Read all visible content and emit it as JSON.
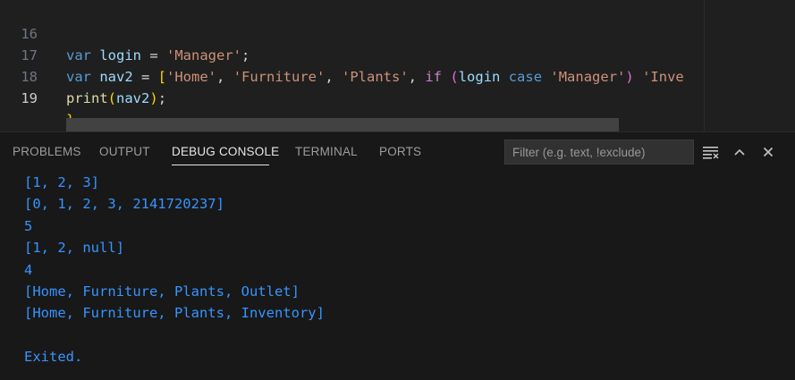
{
  "editor": {
    "lines": [
      {
        "number": "16",
        "active": false,
        "tokens": [
          {
            "t": "var",
            "c": "kw"
          },
          {
            "t": " ",
            "c": "op"
          },
          {
            "t": "login",
            "c": "id"
          },
          {
            "t": " = ",
            "c": "op"
          },
          {
            "t": "'Manager'",
            "c": "str"
          },
          {
            "t": ";",
            "c": "op"
          }
        ]
      },
      {
        "number": "17",
        "active": false,
        "tokens": [
          {
            "t": "var",
            "c": "kw"
          },
          {
            "t": " ",
            "c": "op"
          },
          {
            "t": "nav2",
            "c": "id"
          },
          {
            "t": " = ",
            "c": "op"
          },
          {
            "t": "[",
            "c": "brk1"
          },
          {
            "t": "'Home'",
            "c": "str"
          },
          {
            "t": ", ",
            "c": "op"
          },
          {
            "t": "'Furniture'",
            "c": "str"
          },
          {
            "t": ", ",
            "c": "op"
          },
          {
            "t": "'Plants'",
            "c": "str"
          },
          {
            "t": ", ",
            "c": "op"
          },
          {
            "t": "if",
            "c": "ctl"
          },
          {
            "t": " ",
            "c": "op"
          },
          {
            "t": "(",
            "c": "brk2"
          },
          {
            "t": "login",
            "c": "id"
          },
          {
            "t": " ",
            "c": "op"
          },
          {
            "t": "case",
            "c": "kw"
          },
          {
            "t": " ",
            "c": "op"
          },
          {
            "t": "'Manager'",
            "c": "str"
          },
          {
            "t": ")",
            "c": "brk2"
          },
          {
            "t": " ",
            "c": "op"
          },
          {
            "t": "'Inve",
            "c": "str"
          }
        ]
      },
      {
        "number": "18",
        "active": false,
        "tokens": [
          {
            "t": "print",
            "c": "fn"
          },
          {
            "t": "(",
            "c": "brk1"
          },
          {
            "t": "nav2",
            "c": "id"
          },
          {
            "t": ")",
            "c": "brk1"
          },
          {
            "t": ";",
            "c": "op"
          }
        ]
      },
      {
        "number": "19",
        "active": true,
        "tokens": [
          {
            "t": "}",
            "c": "brk1"
          }
        ]
      }
    ]
  },
  "panel": {
    "tabs": [
      {
        "id": "problems",
        "label": "PROBLEMS",
        "active": false
      },
      {
        "id": "output",
        "label": "OUTPUT",
        "active": false
      },
      {
        "id": "debug-console",
        "label": "DEBUG CONSOLE",
        "active": true
      },
      {
        "id": "terminal",
        "label": "TERMINAL",
        "active": false
      },
      {
        "id": "ports",
        "label": "PORTS",
        "active": false
      }
    ],
    "filter": {
      "placeholder": "Filter (e.g. text, !exclude)",
      "value": ""
    },
    "icons": {
      "filter_clear": "list-filter-icon",
      "maximize": "chevron-up-icon",
      "close": "close-icon"
    },
    "console_output": [
      "[1, 2, 3]",
      "[0, 1, 2, 3, 2141720237]",
      "5",
      "[1, 2, null]",
      "4",
      "[Home, Furniture, Plants, Outlet]",
      "[Home, Furniture, Plants, Inventory]",
      "",
      "Exited."
    ]
  },
  "colors": {
    "editor_bg": "#1f1f1f",
    "panel_bg": "#181818",
    "console_text": "#3794ff",
    "keyword": "#569cd6",
    "string": "#ce9178"
  }
}
